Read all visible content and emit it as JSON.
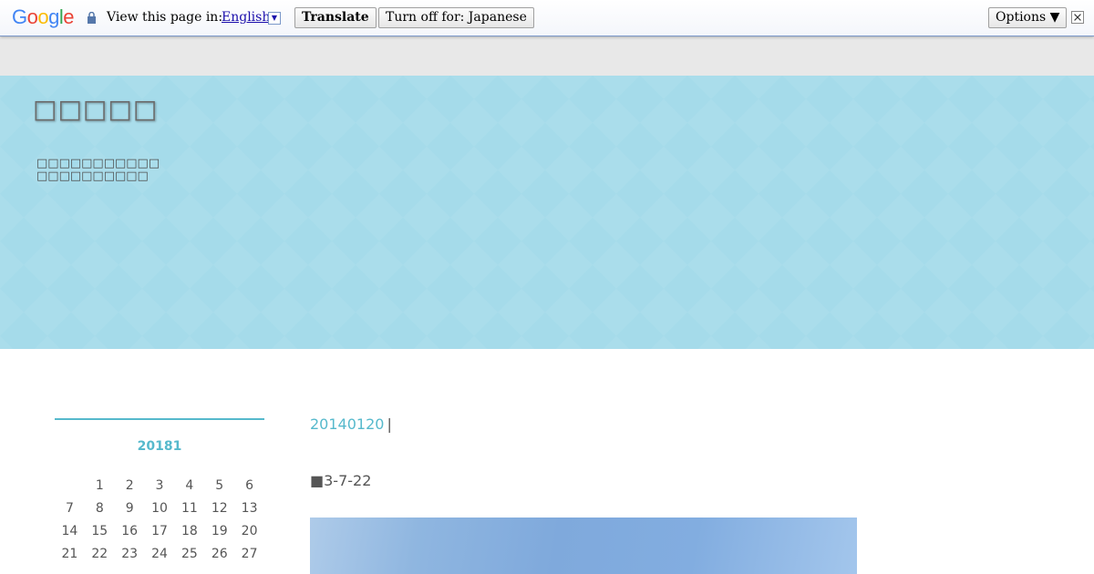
{
  "translate_bar": {
    "logo_text": "Google",
    "view_label": "View this page in:",
    "language": "English",
    "translate_button": "Translate",
    "turn_off_button": "Turn off for: Japanese",
    "options_button": "Options ▼",
    "colors": {
      "blue": "#4285f4",
      "red": "#ea4335",
      "yellow": "#fbbc05",
      "green": "#34a853"
    }
  },
  "header": {
    "site_title": "□□□□□",
    "description_line1": "□□□□□□□□□□□",
    "description_line2": "□□□□□□□□□□",
    "banner_color": "#a5dbea"
  },
  "calendar": {
    "caption": "20181",
    "rows": [
      [
        "",
        "1",
        "2",
        "3",
        "4",
        "5",
        "6"
      ],
      [
        "7",
        "8",
        "9",
        "10",
        "11",
        "12",
        "13"
      ],
      [
        "14",
        "15",
        "16",
        "17",
        "18",
        "19",
        "20"
      ],
      [
        "21",
        "22",
        "23",
        "24",
        "25",
        "26",
        "27"
      ]
    ],
    "accent_color": "#56b9cc"
  },
  "post": {
    "date": "20140120",
    "separator": "|",
    "heading": "■3-7-22"
  }
}
